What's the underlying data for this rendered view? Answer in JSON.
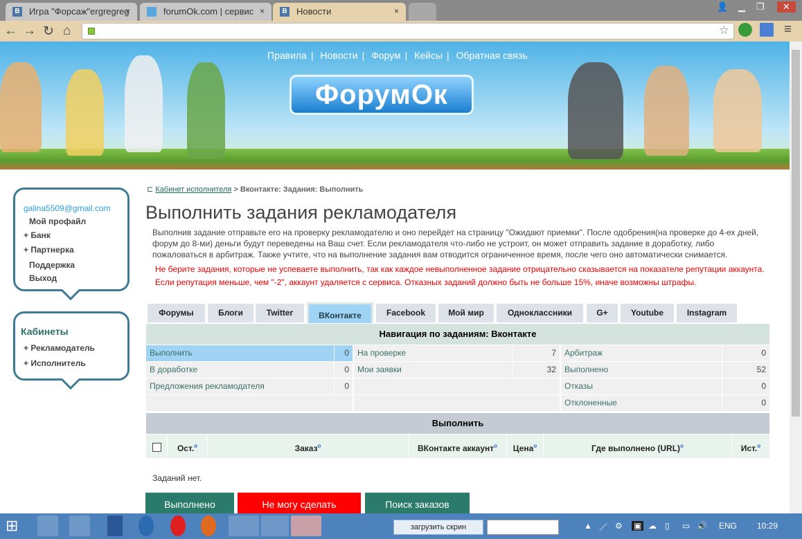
{
  "browser": {
    "tabs": [
      {
        "title": "Игра \"Форсаж\"ergregreg",
        "icon": "vk-icon"
      },
      {
        "title": "forumOk.com | сервис",
        "icon": "forumok-icon"
      },
      {
        "title": "Новости",
        "icon": "vk-icon"
      }
    ],
    "close": "×",
    "fav_letter": "В",
    "url": ""
  },
  "site": {
    "top_nav": [
      "Правила",
      "Новости",
      "Форум",
      "Кейсы",
      "Обратная связь"
    ],
    "separator": "|",
    "logo": "ФорумОк"
  },
  "sidebar": {
    "email": "galina5509@gmail.com",
    "items": [
      {
        "label": "Мой профайл",
        "plus": ""
      },
      {
        "label": "Банк",
        "plus": "+"
      },
      {
        "label": "Партнерка",
        "plus": "+"
      },
      {
        "label": "Поддержка",
        "plus": ""
      },
      {
        "label": "Выход",
        "plus": ""
      }
    ],
    "cabinets_title": "Кабинеты",
    "cabinets": [
      {
        "label": "Рекламодатель",
        "plus": "+"
      },
      {
        "label": "Исполнитель",
        "plus": "+"
      }
    ]
  },
  "breadcrumb": {
    "link": "Кабинет исполнителя",
    "rest": " > Вконтакте: Задания: Выполнить"
  },
  "title": "Выполнить задания рекламодателя",
  "description": "Выполнив задание отправьте его на проверку рекламодателю и оно перейдет на страницу \"Ожидают приемки\". После одобрения(на проверке до 4-ех дней, форум до 8-ми) деньги будут переведены на Ваш счет. Если рекламодателя что-либо не устроит, он может отправить задание в доработку, либо пожаловаться в арбитраж. Также учтите, что на выполнение задания вам отводится ограниченное время, после чего оно автоматически снимается.",
  "warning": "Не берите задания, которые не успеваете выполнить, так как каждое невыполненное задание отрицательно сказывается на показателе репутации аккаунта. Если репутация меньше, чем \"-2\", аккаунт удаляется с сервиса. Отказных заданий должно быть не больше 15%, иначе возможны штрафы.",
  "social_tabs": [
    "Форумы",
    "Блоги",
    "Twitter",
    "ВКонтакте",
    "Facebook",
    "Мой мир",
    "Одноклассники",
    "G+",
    "Youtube",
    "Instagram"
  ],
  "active_tab": "ВКонтакте",
  "nav_header": "Навигация по заданиям: Вконтакте",
  "nav": {
    "col1": [
      {
        "label": "Выполнить",
        "value": "0"
      },
      {
        "label": "В доработке",
        "value": "0"
      },
      {
        "label": "Предложения рекламодателя",
        "value": "0"
      }
    ],
    "col2": [
      {
        "label": "На проверке",
        "value": "7"
      },
      {
        "label": "Мои заявки",
        "value": "32"
      }
    ],
    "col3": [
      {
        "label": "Арбитраж",
        "value": "0"
      },
      {
        "label": "Выполнено",
        "value": "52"
      },
      {
        "label": "Отказы",
        "value": "0"
      },
      {
        "label": "Отклоненные",
        "value": "0"
      }
    ]
  },
  "execute_header": "Выполнить",
  "columns": [
    "Ост.",
    "Заказ",
    "ВКонтакте аккаунт",
    "Цена",
    "Где выполнено (URL)",
    "Ист."
  ],
  "info_mark": "o",
  "empty": "Заданий нет.",
  "buttons": {
    "done": "Выполнено",
    "cant": "Не могу сделать",
    "search": "Поиск заказов"
  },
  "taskbar": {
    "upload": "загрузить скрин",
    "lang": "ENG",
    "time": "10:29"
  }
}
